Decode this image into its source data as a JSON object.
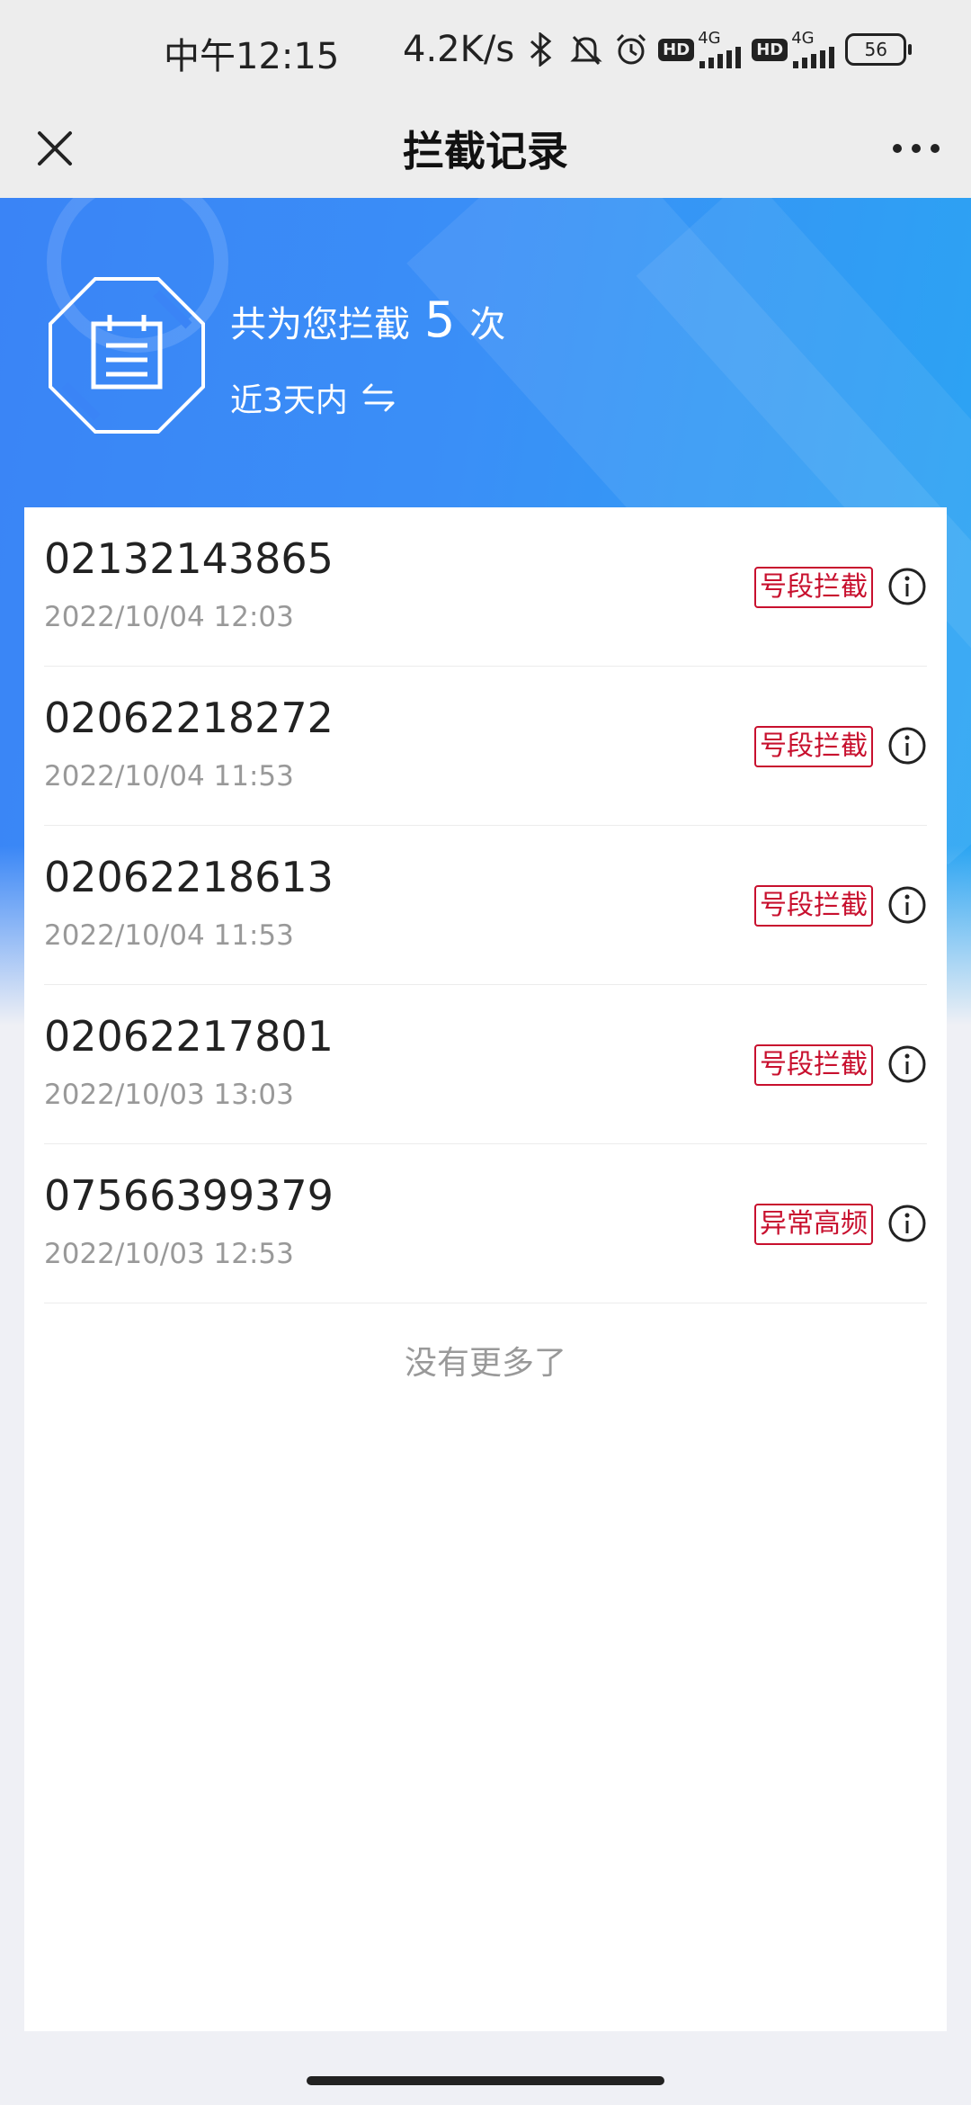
{
  "status_bar": {
    "time": "中午12:15",
    "net_speed": "4.2K/s",
    "icons": [
      "bluetooth-icon",
      "mute-icon",
      "alarm-icon"
    ],
    "sim1": {
      "hd": "HD",
      "net": "4G"
    },
    "sim2": {
      "hd": "HD",
      "net": "4G"
    },
    "battery": "56"
  },
  "nav": {
    "title": "拦截记录",
    "close_icon": "close-icon",
    "more_icon": "more-dots-icon"
  },
  "summary": {
    "prefix": "共为您拦截",
    "count": "5",
    "suffix": "次",
    "period": "近3天内",
    "swap_icon": "swap-arrows-icon",
    "badge_icon": "calendar-shield-icon"
  },
  "colors": {
    "banner_start": "#3a84f6",
    "banner_end": "#2aa6f2",
    "tag_red": "#c8102e"
  },
  "records": [
    {
      "number": "02132143865",
      "time": "2022/10/04 12:03",
      "tag": "号段拦截"
    },
    {
      "number": "02062218272",
      "time": "2022/10/04 11:53",
      "tag": "号段拦截"
    },
    {
      "number": "02062218613",
      "time": "2022/10/04 11:53",
      "tag": "号段拦截"
    },
    {
      "number": "02062217801",
      "time": "2022/10/03 13:03",
      "tag": "号段拦截"
    },
    {
      "number": "07566399379",
      "time": "2022/10/03 12:53",
      "tag": "异常高频"
    }
  ],
  "footer": {
    "no_more": "没有更多了"
  }
}
